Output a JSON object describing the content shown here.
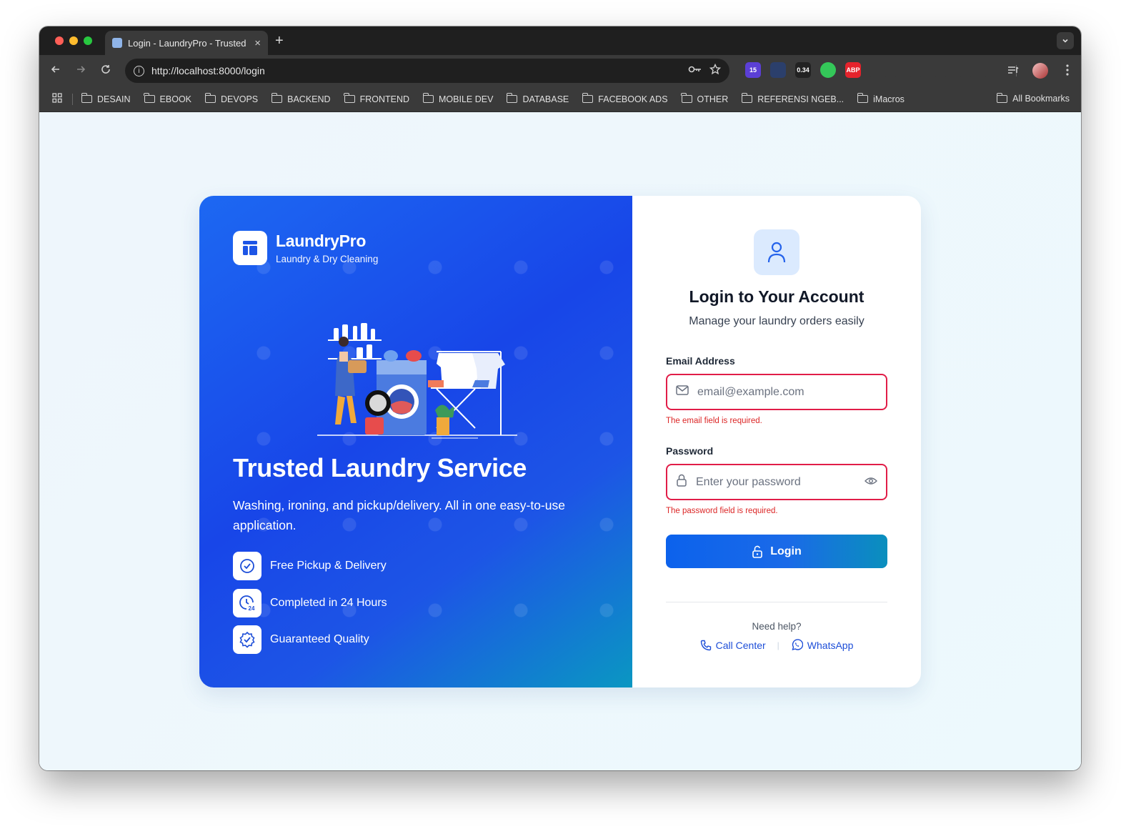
{
  "browser": {
    "tab_title": "Login - LaundryPro - Trusted",
    "tab_close": "×",
    "new_tab": "+",
    "url": "http://localhost:8000/login",
    "extensions": [
      {
        "name": "ext-badge-15",
        "label": "15",
        "color": "#5b3fd6"
      },
      {
        "name": "ext-eye",
        "label": "",
        "color": "#2b3f6b"
      },
      {
        "name": "ext-counter",
        "label": "0.34",
        "color": "#222222"
      },
      {
        "name": "ext-green-dot",
        "label": "",
        "color": "#34c759"
      },
      {
        "name": "ext-abp",
        "label": "ABP",
        "color": "#e5232c"
      },
      {
        "name": "ext-lips",
        "label": "",
        "color": "#3a3a3a"
      },
      {
        "name": "ext-expand",
        "label": "",
        "color": "#3a3a3a"
      },
      {
        "name": "ext-doc",
        "label": "",
        "color": "#3a3a3a"
      },
      {
        "name": "ext-chrome-ring",
        "label": "",
        "color": "#3a3a3a"
      },
      {
        "name": "ext-puzzle",
        "label": "",
        "color": "#3a3a3a"
      }
    ],
    "bookmarks": [
      "DESAIN",
      "EBOOK",
      "DEVOPS",
      "BACKEND",
      "FRONTEND",
      "MOBILE DEV",
      "DATABASE",
      "FACEBOOK ADS",
      "OTHER",
      "REFERENSI NGEB...",
      "iMacros"
    ],
    "all_bookmarks": "All Bookmarks"
  },
  "hero": {
    "brand_name": "LaundryPro",
    "brand_sub": "Laundry & Dry Cleaning",
    "title": "Trusted Laundry Service",
    "description": "Washing, ironing, and pickup/delivery. All in one easy-to-use application.",
    "features": [
      {
        "label": "Free Pickup & Delivery",
        "icon": "check-circle-icon"
      },
      {
        "label": "Completed in 24 Hours",
        "icon": "clock-24-icon"
      },
      {
        "label": "Guaranteed Quality",
        "icon": "badge-check-icon"
      }
    ]
  },
  "form": {
    "title": "Login to Your Account",
    "subtitle": "Manage your laundry orders easily",
    "email_label": "Email Address",
    "email_placeholder": "email@example.com",
    "email_value": "",
    "email_error": "The email field is required.",
    "password_label": "Password",
    "password_placeholder": "Enter your password",
    "password_value": "",
    "password_error": "The password field is required.",
    "login_label": "Login",
    "help_text": "Need help?",
    "call_center": "Call Center",
    "separator": "|",
    "whatsapp": "WhatsApp"
  },
  "colors": {
    "primary": "#1d4ed8",
    "error": "#dc2626",
    "hero_start": "#1d68f2",
    "hero_end": "#0a97c2"
  }
}
